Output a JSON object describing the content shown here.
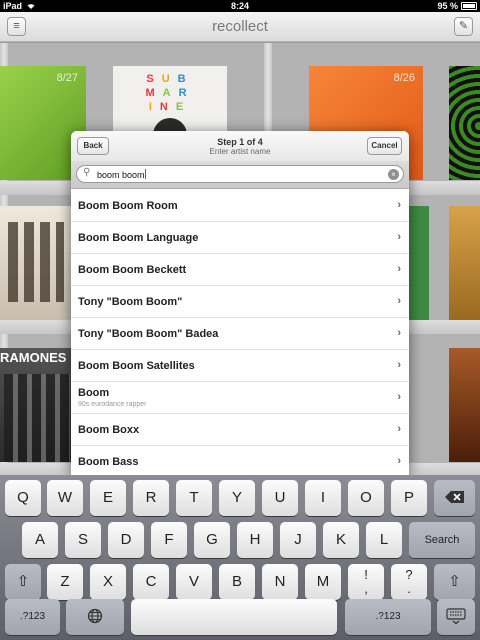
{
  "status_bar": {
    "device": "iPad",
    "time": "8:24",
    "battery": "95 %"
  },
  "nav": {
    "title": "recollect",
    "menu_icon": "list-icon",
    "edit_icon": "compose-icon"
  },
  "shelf": {
    "covers": [
      {
        "id": "green",
        "date": "8/27",
        "color": "#86c43a"
      },
      {
        "id": "submarine",
        "letters": "SUB MAR INE",
        "color": "#f1f0ec"
      },
      {
        "id": "orange",
        "date": "8/26",
        "color": "#f26a22"
      },
      {
        "id": "ministry",
        "color": "#4d8f28"
      },
      {
        "id": "band-photo",
        "color": "#d7cfbe"
      },
      {
        "id": "green-2",
        "color": "#3f8a45"
      },
      {
        "id": "amber",
        "color": "#b8862c"
      },
      {
        "id": "ramones",
        "text": "RAMONES",
        "color": "#3a3a3a"
      },
      {
        "id": "warm-photo",
        "color": "#8a4a22"
      }
    ]
  },
  "popover": {
    "step": "Step 1 of 4",
    "subtitle": "Enter artist name",
    "back_label": "Back",
    "cancel_label": "Cancel",
    "search_value": "boom boom",
    "results": [
      {
        "name": "Boom Boom Room"
      },
      {
        "name": "Boom Boom Language"
      },
      {
        "name": "Boom Boom Beckett"
      },
      {
        "name": "Tony \"Boom Boom\""
      },
      {
        "name": "Tony \"Boom Boom\" Badea"
      },
      {
        "name": "Boom Boom Satellites"
      },
      {
        "name": "Boom",
        "detail": "90s eurodance rapper"
      },
      {
        "name": "Boom Boxx"
      },
      {
        "name": "Boom Bass"
      }
    ]
  },
  "keyboard": {
    "row1": [
      "Q",
      "W",
      "E",
      "R",
      "T",
      "Y",
      "U",
      "I",
      "O",
      "P"
    ],
    "row2": [
      "A",
      "S",
      "D",
      "F",
      "G",
      "H",
      "J",
      "K",
      "L"
    ],
    "row3": [
      "Z",
      "X",
      "C",
      "V",
      "B",
      "N",
      "M",
      "!\n,",
      "?\n."
    ],
    "search_label": "Search",
    "numbers_label": ".?123",
    "backspace_icon": "backspace-icon",
    "shift_icon": "shift-icon",
    "globe_icon": "globe-icon",
    "hide_keyboard_icon": "keyboard-hide-icon"
  }
}
